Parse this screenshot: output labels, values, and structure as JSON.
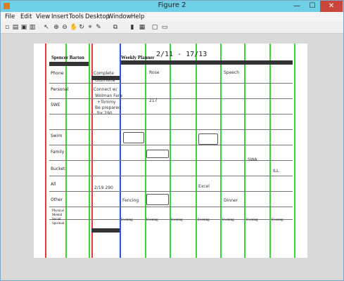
{
  "window": {
    "title": "Figure 2",
    "min": "—",
    "max": "☐",
    "close": "✕"
  },
  "menus": [
    "File",
    "Edit",
    "View",
    "Insert",
    "Tools",
    "Desktop",
    "Window",
    "Help"
  ],
  "planner": {
    "name": "Spencer Barton",
    "weekly": "Weekly Planner",
    "dates": "2/11 - 17/13",
    "rows": [
      "Phone",
      "Personal",
      "SWE",
      "Swim",
      "Family",
      "Bucket",
      "All",
      "Other"
    ],
    "notes": [
      "Complete",
      "OutilTuna",
      "Connect w/",
      "Wolman Fara",
      "+Tommy",
      "Be prepared",
      "for 290"
    ],
    "evenings": [
      "Evening",
      "Evening",
      "Evening",
      "Evening",
      "Evening",
      "Evening",
      "Evening"
    ],
    "bottom_labels": [
      "Physical",
      "Mental",
      "Social",
      "Spiritual"
    ],
    "bits": [
      "Rose",
      "Speech",
      "Excel",
      "Dinner",
      "SWA",
      "ILL",
      "2/19 290",
      "Fencing",
      "217"
    ]
  }
}
